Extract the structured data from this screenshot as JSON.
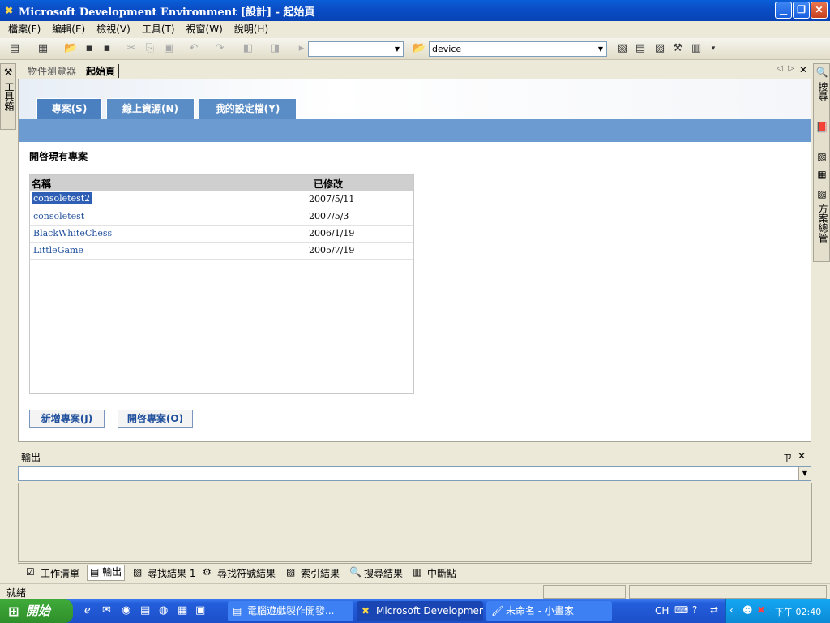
{
  "window": {
    "title": "Microsoft Development Environment [設計] - 起始頁"
  },
  "menu": [
    "檔案(F)",
    "編輯(E)",
    "檢視(V)",
    "工具(T)",
    "視窗(W)",
    "說明(H)"
  ],
  "toolbar": {
    "config_combo": "",
    "device_combo": "device"
  },
  "left_toolbox": {
    "label": "工具箱"
  },
  "right_panels": {
    "search": "搜尋",
    "solution": "方案總管"
  },
  "doc_tabs": [
    {
      "label": "物件瀏覽器"
    },
    {
      "label": "起始頁"
    }
  ],
  "start_page": {
    "tabs": [
      "專案(S)",
      "線上資源(N)",
      "我的設定檔(Y)"
    ],
    "section_title": "開啓現有專案",
    "columns": {
      "name": "名稱",
      "modified": "已修改"
    },
    "projects": [
      {
        "name": "consoletest2",
        "date": "2007/5/11"
      },
      {
        "name": "consoletest",
        "date": "2007/5/3"
      },
      {
        "name": "BlackWhiteChess",
        "date": "2006/1/19"
      },
      {
        "name": "LittleGame",
        "date": "2005/7/19"
      }
    ],
    "new_project": "新增專案(J)",
    "open_project": "開啓專案(O)"
  },
  "output": {
    "title": "輸出",
    "pin": "ㄗ",
    "close": "✕"
  },
  "bottom_tabs": [
    "工作清單",
    "輸出",
    "尋找結果 1",
    "尋找符號結果",
    "索引結果",
    "搜尋結果",
    "中斷點"
  ],
  "status": {
    "text": "就緒"
  },
  "taskbar": {
    "start": "開始",
    "tasks": [
      "電腦遊戲製作開發...",
      "Microsoft Developmen...",
      "未命名 - 小畫家"
    ],
    "lang": "CH",
    "clock": "下午 02:40"
  }
}
